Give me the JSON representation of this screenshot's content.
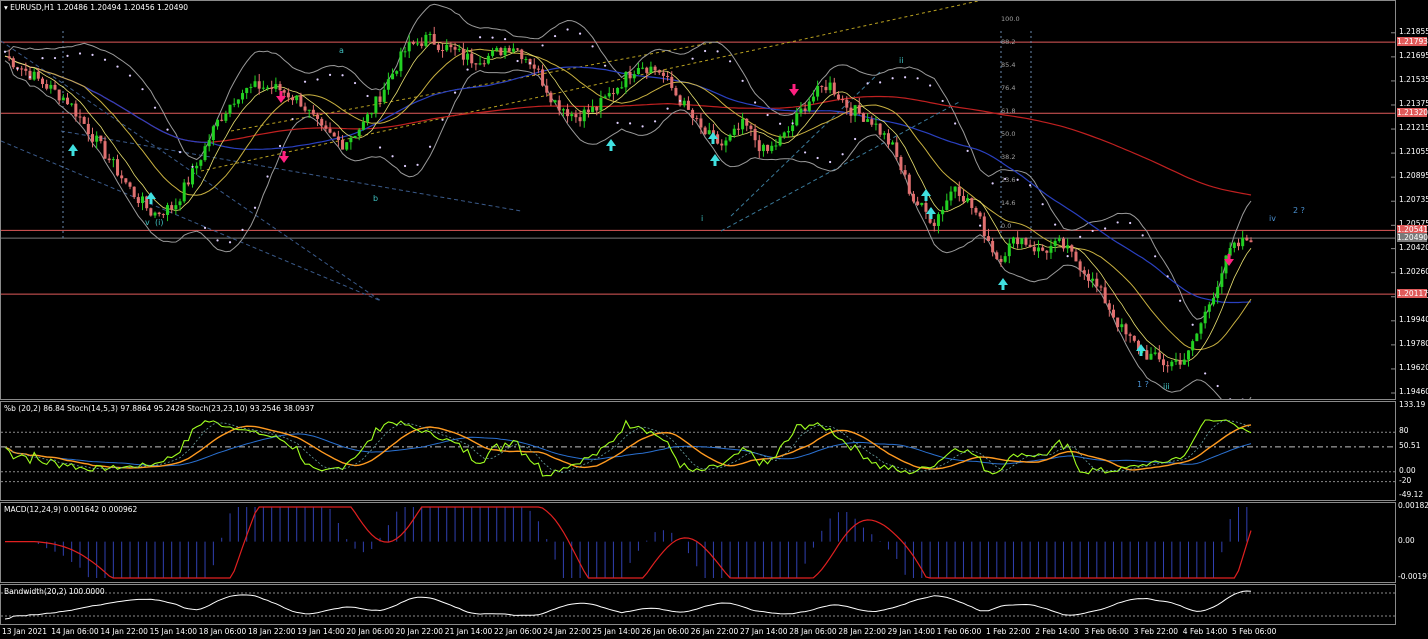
{
  "chart_data": {
    "type": "candlestick",
    "symbol_header": "EURUSD,H1  1.20486 1.20494 1.20456 1.20490",
    "price_axis_ticks": [
      "1.21855",
      "1.21695",
      "1.21535",
      "1.21375",
      "1.21215",
      "1.21055",
      "1.20895",
      "1.20735",
      "1.20575",
      "1.20420",
      "1.20260",
      "1.20100",
      "1.19940",
      "1.19780",
      "1.19620",
      "1.19460"
    ],
    "price_range": [
      1.1946,
      1.2196
    ],
    "horizontal_levels": [
      {
        "label": "1.21793",
        "price": 1.21793,
        "color": "#e05a5a"
      },
      {
        "label": "1.21320",
        "price": 1.2132,
        "color": "#e05a5a"
      },
      {
        "label": "1.20541",
        "price": 1.20541,
        "color": "#e05a5a"
      },
      {
        "label": "1.20490",
        "price": 1.2049,
        "color": "#7a7a7a"
      },
      {
        "label": "1.20117",
        "price": 1.20117,
        "color": "#e05a5a"
      }
    ],
    "time_axis": [
      "13 Jan 2021",
      "14 Jan 06:00",
      "14 Jan 22:00",
      "15 Jan 14:00",
      "18 Jan 06:00",
      "18 Jan 22:00",
      "19 Jan 14:00",
      "20 Jan 06:00",
      "20 Jan 22:00",
      "21 Jan 14:00",
      "22 Jan 06:00",
      "24 Jan 22:00",
      "25 Jan 14:00",
      "26 Jan 06:00",
      "26 Jan 22:00",
      "27 Jan 14:00",
      "28 Jan 06:00",
      "28 Jan 22:00",
      "29 Jan 14:00",
      "1 Feb 06:00",
      "1 Feb 22:00",
      "2 Feb 14:00",
      "3 Feb 06:00",
      "3 Feb 22:00",
      "4 Feb 14:00",
      "5 Feb 06:00"
    ],
    "close_path": [
      1.217,
      1.216,
      1.215,
      1.214,
      1.212,
      1.21,
      1.208,
      1.2065,
      1.207,
      1.2095,
      1.2125,
      1.2145,
      1.215,
      1.2148,
      1.214,
      1.212,
      1.2112,
      1.2125,
      1.215,
      1.2175,
      1.2182,
      1.2175,
      1.2168,
      1.217,
      1.2178,
      1.2165,
      1.214,
      1.213,
      1.2135,
      1.215,
      1.2165,
      1.216,
      1.214,
      1.212,
      1.211,
      1.2125,
      1.2105,
      1.2118,
      1.214,
      1.2152,
      1.2135,
      1.2128,
      1.211,
      1.2075,
      1.206,
      1.2085,
      1.2065,
      1.2035,
      1.205,
      1.204,
      1.2045,
      1.203,
      1.201,
      1.1985,
      1.1972,
      1.1965,
      1.197,
      1.2005,
      1.204,
      1.205
    ],
    "fib_levels": [
      "100.0",
      "88.2",
      "85.4",
      "76.4",
      "61.8",
      "50.0",
      "38.2",
      "23.6",
      "14.6",
      "0.0"
    ],
    "wave_labels": [
      "a",
      "b",
      "ii",
      "i",
      "iii",
      "iv",
      "2 ?",
      "1 ?",
      "v",
      "(i)"
    ],
    "indicator1": {
      "title": "%b (20,2) 86.84  Stoch(14,5,3) 97.8864 95.2428  Stoch(23,23,10) 93.2546 38.0937",
      "ticks": [
        "133.19",
        "80",
        "50.51",
        "0.00",
        "-20",
        "-49.12"
      ]
    },
    "indicator2": {
      "title": "MACD(12,24,9) 0.001642 0.000962",
      "ticks": [
        "0.001821",
        "0.00",
        "-0.001912"
      ]
    },
    "indicator3": {
      "title": "Bandwidth(20,2) 100.0000",
      "ticks": []
    }
  }
}
